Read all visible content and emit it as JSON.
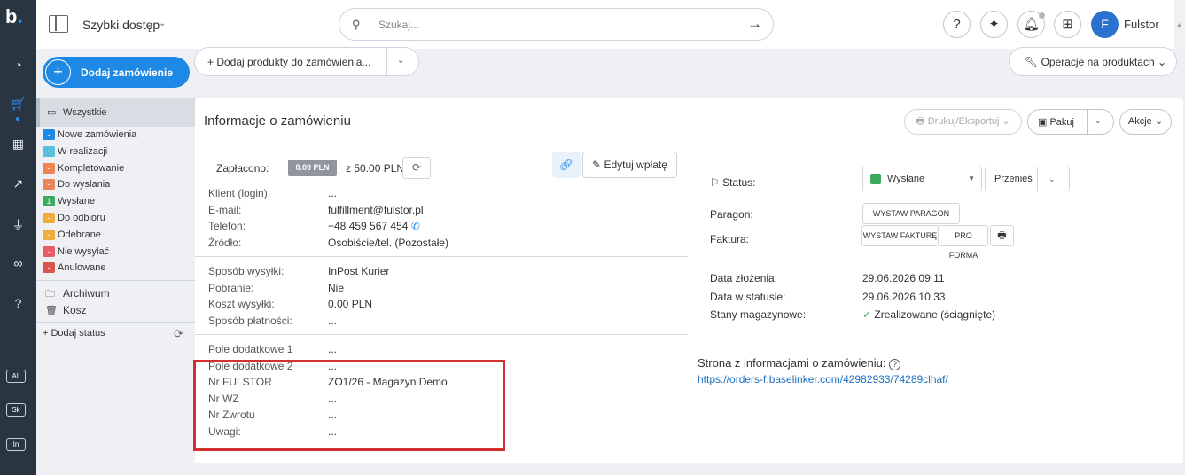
{
  "app": {
    "logo": "b",
    "logo_dot": "."
  },
  "rail": {
    "icons": [
      "dashboard-icon",
      "cart-icon",
      "warehouse-icon",
      "chart-icon",
      "plug-icon",
      "link-icon",
      "help-icon"
    ],
    "labels": [
      "All",
      "Sk",
      "In"
    ]
  },
  "topbar": {
    "quick_access": "Szybki dostęp",
    "search_placeholder": "Szukaj...",
    "user_initial": "F",
    "user_name": "Fulstor"
  },
  "actions": {
    "add_order": "Dodaj zamówienie",
    "add_products": "Dodaj produkty do zamówienia...",
    "product_ops": "Operacje na produktach"
  },
  "statuses": {
    "all_label": "Wszystkie",
    "items": [
      {
        "label": "Nowe zamówienia",
        "badge": "-",
        "color": "#1e88e5"
      },
      {
        "label": "W realizacji",
        "badge": "-",
        "color": "#5bc0de"
      },
      {
        "label": "Kompletowanie",
        "badge": "-",
        "color": "#ef8354"
      },
      {
        "label": "Do wysłania",
        "badge": "-",
        "color": "#e8855a"
      },
      {
        "label": "Wysłane",
        "badge": "1",
        "color": "#3aaa5c"
      },
      {
        "label": "Do odbioru",
        "badge": "-",
        "color": "#f0ad3c"
      },
      {
        "label": "Odebrane",
        "badge": "-",
        "color": "#f0ad3c"
      },
      {
        "label": "Nie wysyłać",
        "badge": "-",
        "color": "#e85c6a"
      },
      {
        "label": "Anulowane",
        "badge": "-",
        "color": "#d9534f"
      }
    ],
    "archive": "Archiwum",
    "trash": "Kosz",
    "add_status": "+ Dodaj status"
  },
  "order": {
    "title": "Informacje o zamówieniu",
    "print_btn": "Drukuj/Eksportuj",
    "pack_btn": "Pakuj",
    "actions_btn": "Akcje",
    "paid_label": "Zapłacono:",
    "paid_value": "0.00 PLN",
    "paid_of": "z 50.00 PLN",
    "edit_payment": "Edytuj wpłatę",
    "client_fields": [
      {
        "label": "Klient (login):",
        "value": "..."
      },
      {
        "label": "E-mail:",
        "value": "fulfillment@fulstor.pl"
      },
      {
        "label": "Telefon:",
        "value": "+48 459 567 454"
      },
      {
        "label": "Źródło:",
        "value": "Osobiście/tel. (Pozostałe)"
      }
    ],
    "shipping_fields": [
      {
        "label": "Sposób wysyłki:",
        "value": "InPost Kurier"
      },
      {
        "label": "Pobranie:",
        "value": "Nie"
      },
      {
        "label": "Koszt wysyłki:",
        "value": "0.00 PLN"
      },
      {
        "label": "Sposób płatności:",
        "value": "..."
      }
    ],
    "extra_fields": [
      {
        "label": "Pole dodatkowe 1",
        "value": "..."
      },
      {
        "label": "Pole dodatkowe 2",
        "value": "..."
      },
      {
        "label": "Nr FULSTOR",
        "value": "ZO1/26 - Magazyn Demo"
      },
      {
        "label": "Nr WZ",
        "value": "..."
      },
      {
        "label": "Nr Zwrotu",
        "value": "..."
      },
      {
        "label": "Uwagi:",
        "value": "..."
      }
    ],
    "status_label": "Status:",
    "status_value": "Wysłane",
    "status_color": "#3aaa5c",
    "move_btn": "Przenieś",
    "receipt_label": "Paragon:",
    "receipt_btn": "WYSTAW PARAGON",
    "invoice_label": "Faktura:",
    "invoice_btn": "WYSTAW FAKTURĘ",
    "proforma_btn": "PRO FORMA",
    "dates": [
      {
        "label": "Data złożenia:",
        "value": "29.06.2026 09:11"
      },
      {
        "label": "Data w statusie:",
        "value": "29.06.2026 10:33"
      },
      {
        "label": "Stany magazynowe:",
        "value": "Zrealizowane (ściągnięte)"
      }
    ],
    "page_info_title": "Strona z informacjami o zamówieniu:",
    "page_info_link": "https://orders-f.baselinker.com/42982933/74289clhaf/"
  }
}
